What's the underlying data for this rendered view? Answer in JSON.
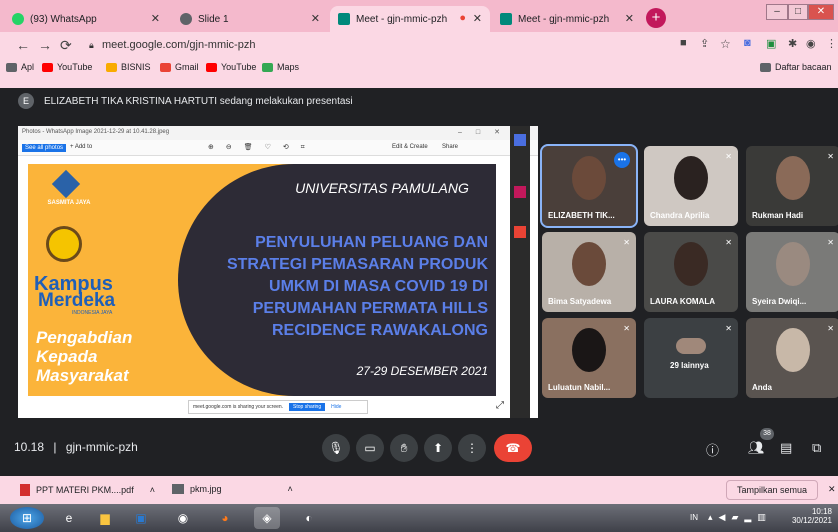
{
  "tabs": [
    {
      "label": "(93) WhatsApp",
      "favicon_color": "#25d366"
    },
    {
      "label": "Slide 1",
      "favicon_color": "#5f6368"
    },
    {
      "label": "Meet - gjn-mmic-pzh",
      "favicon_color": "#00897b"
    },
    {
      "label": "Meet - gjn-mmic-pzh",
      "favicon_color": "#00897b"
    }
  ],
  "address": {
    "url": "meet.google.com/gjn-mmic-pzh"
  },
  "bookmarks": [
    {
      "label": "Apl",
      "color": "#5f6368"
    },
    {
      "label": "YouTube",
      "color": "#ff0000"
    },
    {
      "label": "BISNIS",
      "color": "#f9ab00"
    },
    {
      "label": "Gmail",
      "color": "#ea4335"
    },
    {
      "label": "YouTube",
      "color": "#ff0000"
    },
    {
      "label": "Maps",
      "color": "#34a853"
    }
  ],
  "bookmarks_other": "Daftar bacaan",
  "banner": {
    "avatar": "E",
    "text": "ELIZABETH TIKA KRISTINA HARTUTI sedang melakukan presentasi"
  },
  "presentation": {
    "viewer_title": "Photos - WhatsApp Image 2021-12-29 at 10.41.28.jpeg",
    "see_all": "See all photos",
    "add_to": "+ Add to",
    "edit": "Edit & Create",
    "share": "Share",
    "slide": {
      "org": "SASMITA JAYA",
      "univ": "UNIVERSITAS PAMULANG",
      "title_lines": [
        "PENYULUHAN PELUANG DAN",
        "STRATEGI PEMASARAN PRODUK",
        "UMKM DI MASA COVID 19 DI",
        "PERUMAHAN PERMATA HILLS",
        "RECIDENCE RAWAKALONG"
      ],
      "date": "27-29 DESEMBER 2021",
      "kampus": "Kampus",
      "merdeka": "Merdeka",
      "indonesia": "INDONESIA JAYA",
      "abdimas": [
        "Pengabdian",
        "Kepada",
        "Masyarakat"
      ]
    },
    "sharing_notice": "meet.google.com is sharing your screen.",
    "stop_sharing": "Stop sharing",
    "hide": "Hide"
  },
  "participants": [
    {
      "name": "ELIZABETH TIK...",
      "bg": "#4a3f3a",
      "face": "#6b4a3a"
    },
    {
      "name": "Chandra Aprilia",
      "bg": "#cfc8c2",
      "face": "#2a2220"
    },
    {
      "name": "Rukman Hadi",
      "bg": "#3a3a38",
      "face": "#8a6a58"
    },
    {
      "name": "Bima Satyadewa",
      "bg": "#b8b0a8",
      "face": "#6a4a3a"
    },
    {
      "name": "LAURA KOMALA",
      "bg": "#4a4a48",
      "face": "#3a2a24"
    },
    {
      "name": "Syeira Dwiqi...",
      "bg": "#7a7a78",
      "face": "#9a8a80"
    },
    {
      "name": "Luluatun Nabil...",
      "bg": "#8a7060",
      "face": "#1a1616"
    },
    {
      "name": "29 lainnya",
      "bg": "#3c4043",
      "face": "#3c4043"
    },
    {
      "name": "Anda",
      "bg": "#5a5450",
      "face": "#c8b8a8"
    }
  ],
  "meeting": {
    "time": "10.18",
    "separator": "|",
    "code": "gjn-mmic-pzh",
    "participant_count": "38"
  },
  "downloads": [
    {
      "label": "PPT MATERI PKM....pdf",
      "icon": "pdf-icon"
    },
    {
      "label": "pkm.jpg",
      "icon": "image-icon"
    }
  ],
  "show_all": "Tampilkan semua",
  "taskbar": {
    "lang": "IN",
    "clock_time": "10:18",
    "clock_date": "30/12/2021"
  },
  "colors": {
    "accent": "#c2185b",
    "meet_dark": "#202124",
    "end_call": "#ea4335",
    "stop_share": "#1a73e8"
  }
}
